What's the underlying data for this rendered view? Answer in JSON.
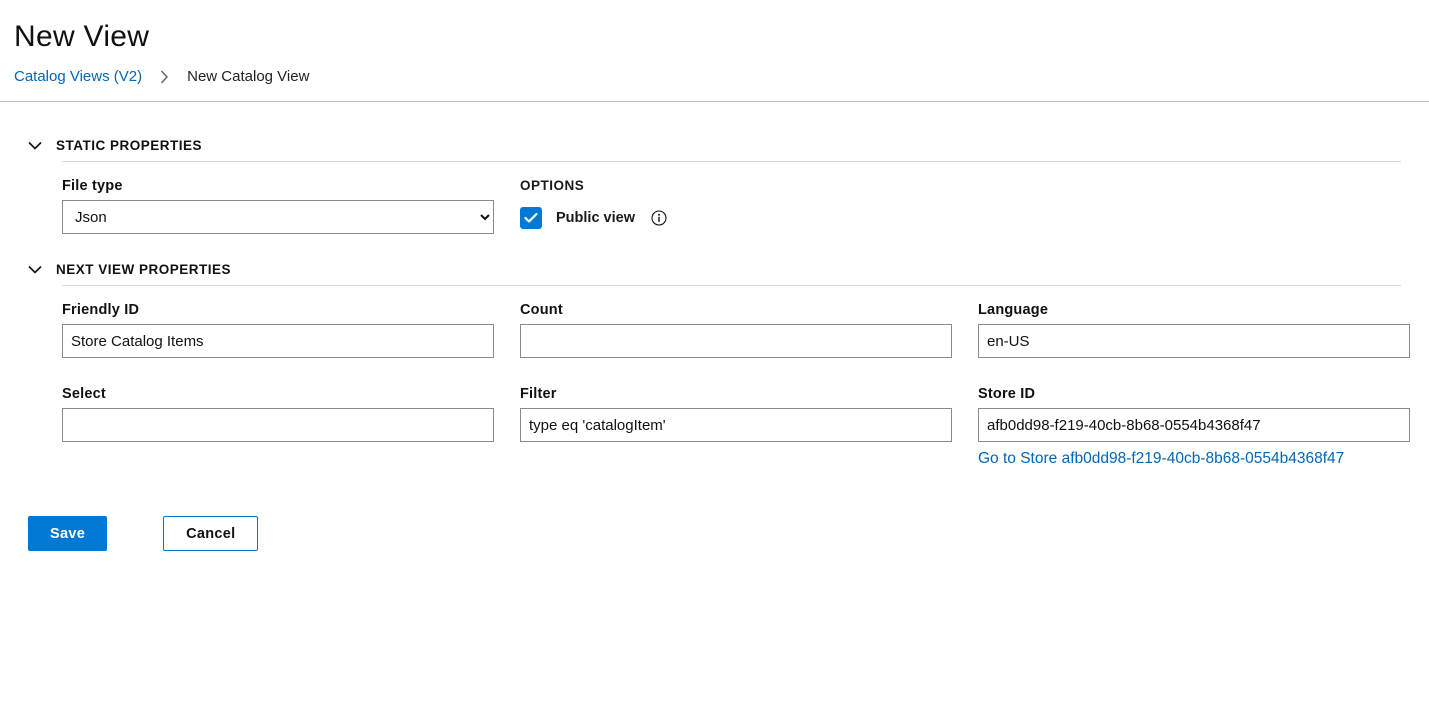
{
  "title": "New View",
  "breadcrumb": {
    "parent": "Catalog Views (V2)",
    "current": "New Catalog View"
  },
  "sections": {
    "static": {
      "heading": "STATIC PROPERTIES"
    },
    "next": {
      "heading": "NEXT VIEW PROPERTIES"
    }
  },
  "fields": {
    "fileType": {
      "label": "File type",
      "value": "Json"
    },
    "options": {
      "heading": "OPTIONS",
      "publicView": {
        "label": "Public view",
        "checked": true
      }
    },
    "friendlyId": {
      "label": "Friendly ID",
      "value": "Store Catalog Items"
    },
    "count": {
      "label": "Count",
      "value": ""
    },
    "language": {
      "label": "Language",
      "value": "en-US"
    },
    "select": {
      "label": "Select",
      "value": ""
    },
    "filter": {
      "label": "Filter",
      "value": "type eq 'catalogItem'"
    },
    "storeId": {
      "label": "Store ID",
      "value": "afb0dd98-f219-40cb-8b68-0554b4368f47",
      "link": "Go to Store afb0dd98-f219-40cb-8b68-0554b4368f47"
    }
  },
  "buttons": {
    "save": "Save",
    "cancel": "Cancel"
  }
}
